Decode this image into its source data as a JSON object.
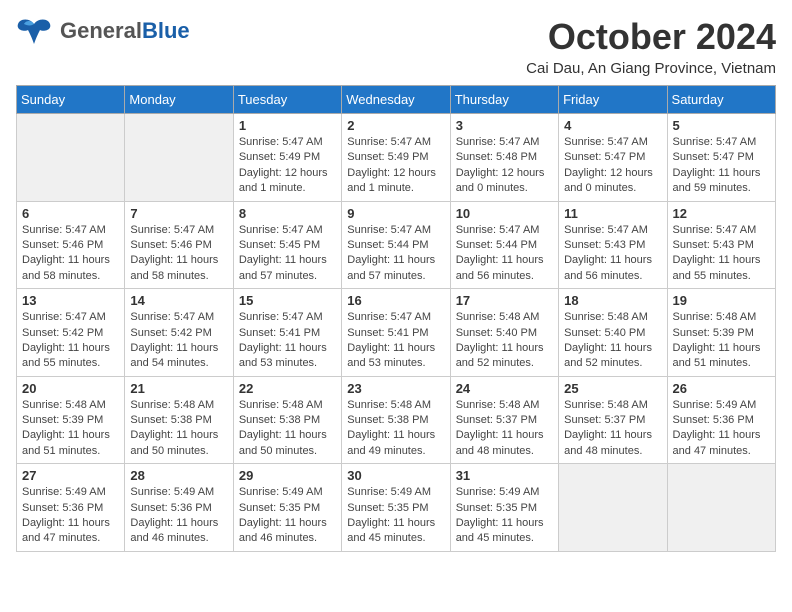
{
  "header": {
    "logo_general": "General",
    "logo_blue": "Blue",
    "title": "October 2024",
    "location": "Cai Dau, An Giang Province, Vietnam"
  },
  "days_of_week": [
    "Sunday",
    "Monday",
    "Tuesday",
    "Wednesday",
    "Thursday",
    "Friday",
    "Saturday"
  ],
  "weeks": [
    [
      {
        "day": "",
        "info": ""
      },
      {
        "day": "",
        "info": ""
      },
      {
        "day": "1",
        "info": "Sunrise: 5:47 AM\nSunset: 5:49 PM\nDaylight: 12 hours\nand 1 minute."
      },
      {
        "day": "2",
        "info": "Sunrise: 5:47 AM\nSunset: 5:49 PM\nDaylight: 12 hours\nand 1 minute."
      },
      {
        "day": "3",
        "info": "Sunrise: 5:47 AM\nSunset: 5:48 PM\nDaylight: 12 hours\nand 0 minutes."
      },
      {
        "day": "4",
        "info": "Sunrise: 5:47 AM\nSunset: 5:47 PM\nDaylight: 12 hours\nand 0 minutes."
      },
      {
        "day": "5",
        "info": "Sunrise: 5:47 AM\nSunset: 5:47 PM\nDaylight: 11 hours\nand 59 minutes."
      }
    ],
    [
      {
        "day": "6",
        "info": "Sunrise: 5:47 AM\nSunset: 5:46 PM\nDaylight: 11 hours\nand 58 minutes."
      },
      {
        "day": "7",
        "info": "Sunrise: 5:47 AM\nSunset: 5:46 PM\nDaylight: 11 hours\nand 58 minutes."
      },
      {
        "day": "8",
        "info": "Sunrise: 5:47 AM\nSunset: 5:45 PM\nDaylight: 11 hours\nand 57 minutes."
      },
      {
        "day": "9",
        "info": "Sunrise: 5:47 AM\nSunset: 5:44 PM\nDaylight: 11 hours\nand 57 minutes."
      },
      {
        "day": "10",
        "info": "Sunrise: 5:47 AM\nSunset: 5:44 PM\nDaylight: 11 hours\nand 56 minutes."
      },
      {
        "day": "11",
        "info": "Sunrise: 5:47 AM\nSunset: 5:43 PM\nDaylight: 11 hours\nand 56 minutes."
      },
      {
        "day": "12",
        "info": "Sunrise: 5:47 AM\nSunset: 5:43 PM\nDaylight: 11 hours\nand 55 minutes."
      }
    ],
    [
      {
        "day": "13",
        "info": "Sunrise: 5:47 AM\nSunset: 5:42 PM\nDaylight: 11 hours\nand 55 minutes."
      },
      {
        "day": "14",
        "info": "Sunrise: 5:47 AM\nSunset: 5:42 PM\nDaylight: 11 hours\nand 54 minutes."
      },
      {
        "day": "15",
        "info": "Sunrise: 5:47 AM\nSunset: 5:41 PM\nDaylight: 11 hours\nand 53 minutes."
      },
      {
        "day": "16",
        "info": "Sunrise: 5:47 AM\nSunset: 5:41 PM\nDaylight: 11 hours\nand 53 minutes."
      },
      {
        "day": "17",
        "info": "Sunrise: 5:48 AM\nSunset: 5:40 PM\nDaylight: 11 hours\nand 52 minutes."
      },
      {
        "day": "18",
        "info": "Sunrise: 5:48 AM\nSunset: 5:40 PM\nDaylight: 11 hours\nand 52 minutes."
      },
      {
        "day": "19",
        "info": "Sunrise: 5:48 AM\nSunset: 5:39 PM\nDaylight: 11 hours\nand 51 minutes."
      }
    ],
    [
      {
        "day": "20",
        "info": "Sunrise: 5:48 AM\nSunset: 5:39 PM\nDaylight: 11 hours\nand 51 minutes."
      },
      {
        "day": "21",
        "info": "Sunrise: 5:48 AM\nSunset: 5:38 PM\nDaylight: 11 hours\nand 50 minutes."
      },
      {
        "day": "22",
        "info": "Sunrise: 5:48 AM\nSunset: 5:38 PM\nDaylight: 11 hours\nand 50 minutes."
      },
      {
        "day": "23",
        "info": "Sunrise: 5:48 AM\nSunset: 5:38 PM\nDaylight: 11 hours\nand 49 minutes."
      },
      {
        "day": "24",
        "info": "Sunrise: 5:48 AM\nSunset: 5:37 PM\nDaylight: 11 hours\nand 48 minutes."
      },
      {
        "day": "25",
        "info": "Sunrise: 5:48 AM\nSunset: 5:37 PM\nDaylight: 11 hours\nand 48 minutes."
      },
      {
        "day": "26",
        "info": "Sunrise: 5:49 AM\nSunset: 5:36 PM\nDaylight: 11 hours\nand 47 minutes."
      }
    ],
    [
      {
        "day": "27",
        "info": "Sunrise: 5:49 AM\nSunset: 5:36 PM\nDaylight: 11 hours\nand 47 minutes."
      },
      {
        "day": "28",
        "info": "Sunrise: 5:49 AM\nSunset: 5:36 PM\nDaylight: 11 hours\nand 46 minutes."
      },
      {
        "day": "29",
        "info": "Sunrise: 5:49 AM\nSunset: 5:35 PM\nDaylight: 11 hours\nand 46 minutes."
      },
      {
        "day": "30",
        "info": "Sunrise: 5:49 AM\nSunset: 5:35 PM\nDaylight: 11 hours\nand 45 minutes."
      },
      {
        "day": "31",
        "info": "Sunrise: 5:49 AM\nSunset: 5:35 PM\nDaylight: 11 hours\nand 45 minutes."
      },
      {
        "day": "",
        "info": ""
      },
      {
        "day": "",
        "info": ""
      }
    ]
  ]
}
